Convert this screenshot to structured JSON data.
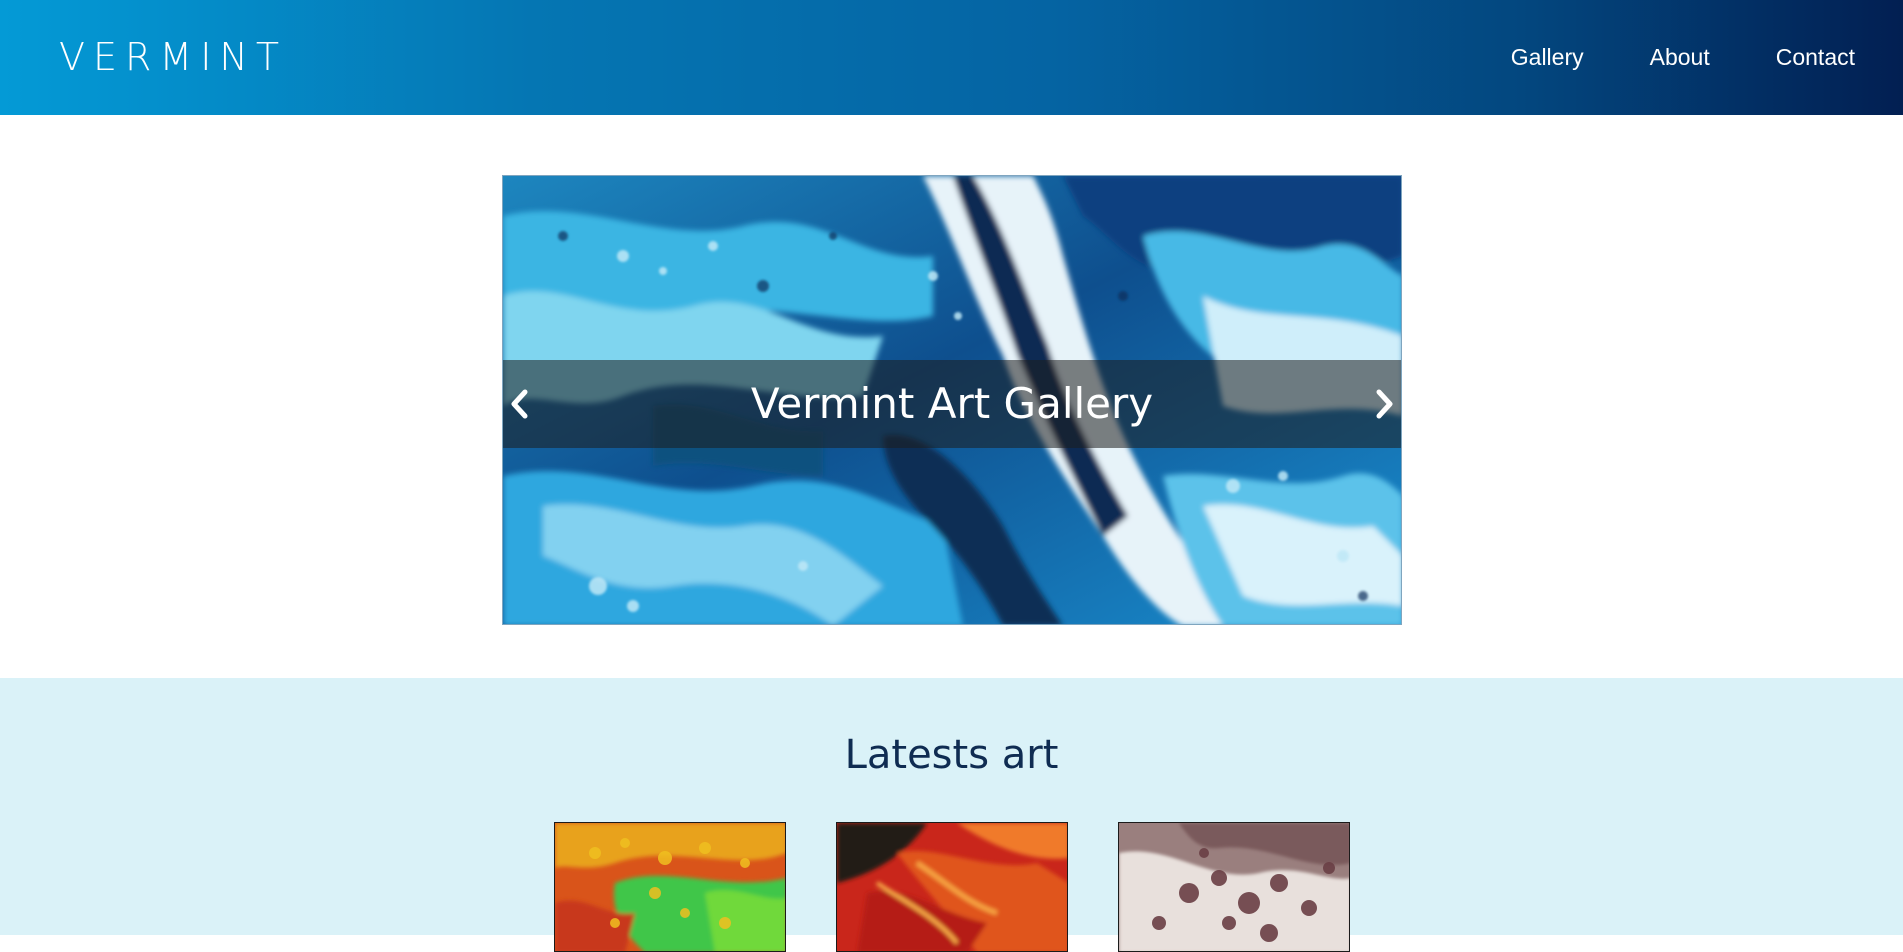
{
  "header": {
    "logo": "VERMINT",
    "nav": [
      {
        "label": "Gallery"
      },
      {
        "label": "About"
      },
      {
        "label": "Contact"
      }
    ]
  },
  "hero": {
    "title": "Vermint Art Gallery",
    "prev_icon": "chevron-left-icon",
    "next_icon": "chevron-right-icon"
  },
  "latest": {
    "title": "Latests art",
    "thumbnails": [
      {
        "name": "artwork-thumbnail-green-orange"
      },
      {
        "name": "artwork-thumbnail-red-flame"
      },
      {
        "name": "artwork-thumbnail-mauve-cells"
      }
    ]
  },
  "colors": {
    "header_start": "#049ad6",
    "header_end": "#021f52",
    "latest_bg": "#daf2f8",
    "heading_text": "#0f2c52"
  }
}
